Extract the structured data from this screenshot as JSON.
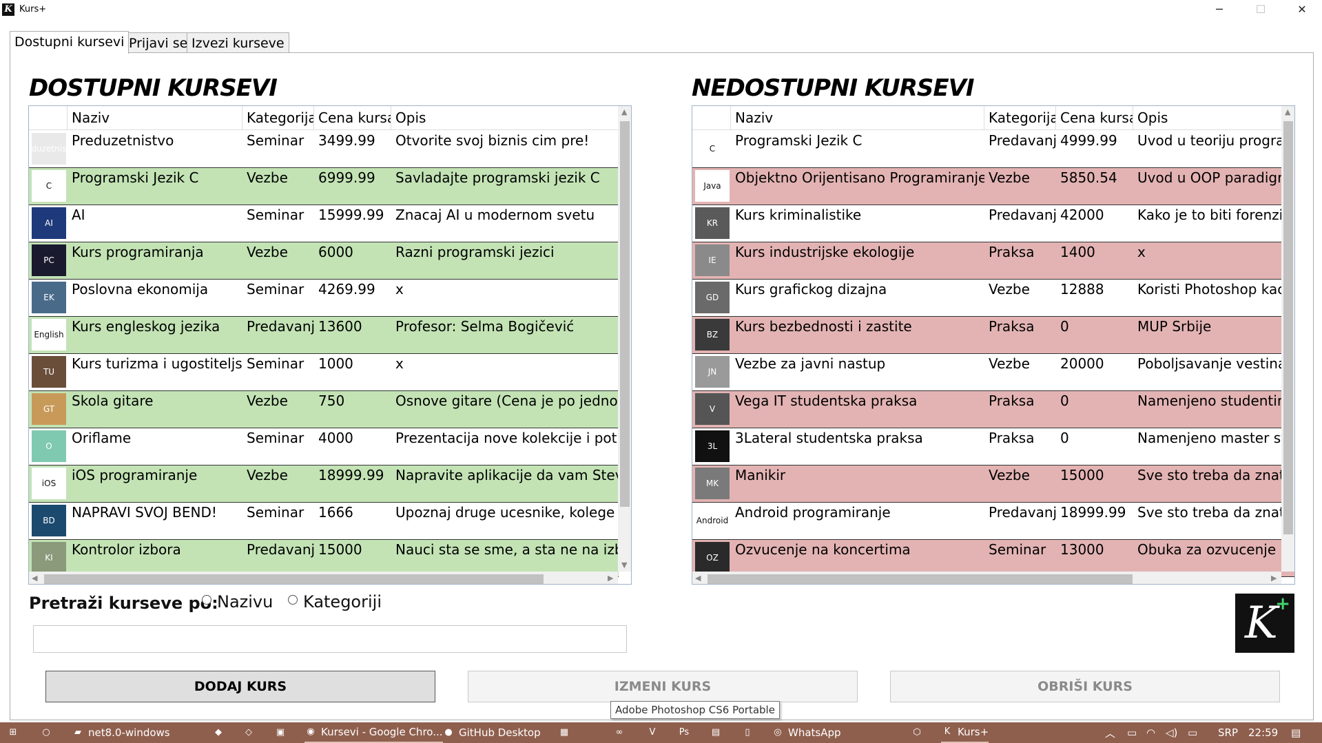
{
  "window": {
    "title": "Kurs+",
    "icon_letter": "K",
    "minimize": "─",
    "maximize": "☐",
    "close": "✕"
  },
  "tabs": [
    {
      "label": "Dostupni kursevi"
    },
    {
      "label": "Prijavi se"
    },
    {
      "label": "Izvezi kurseve"
    }
  ],
  "available": {
    "title": "DOSTUPNI KURSEVI",
    "columns": [
      "",
      "Naziv",
      "Kategorija",
      "Cena kursa",
      "Opis"
    ],
    "rows": [
      {
        "thumb": "Preduzetnistvo",
        "name": "Preduzetnistvo",
        "category": "Seminar",
        "price": "3499.99",
        "desc": "Otvorite svoj biznis cim pre!",
        "thumb_color": "#e9e9e9"
      },
      {
        "thumb": "C",
        "name": "Programski Jezik C",
        "category": "Vezbe",
        "price": "6999.99",
        "desc": "Savladajte programski jezik C",
        "thumb_color": "#ffffff"
      },
      {
        "thumb": "AI",
        "name": "AI",
        "category": "Seminar",
        "price": "15999.99",
        "desc": "Znacaj AI u modernom svetu",
        "thumb_color": "#1e3a7a"
      },
      {
        "thumb": "PC",
        "name": "Kurs programiranja",
        "category": "Vezbe",
        "price": "6000",
        "desc": "Razni programski jezici",
        "thumb_color": "#1a1a2e"
      },
      {
        "thumb": "EK",
        "name": "Poslovna ekonomija",
        "category": "Seminar",
        "price": "4269.99",
        "desc": "x",
        "thumb_color": "#4a6a8a"
      },
      {
        "thumb": "English",
        "name": "Kurs engleskog jezika",
        "category": "Predavanja",
        "price": "13600",
        "desc": "Profesor: Selma Bogičević",
        "thumb_color": "#ffffff"
      },
      {
        "thumb": "TU",
        "name": "Kurs turizma i ugostiteljstvo",
        "category": "Seminar",
        "price": "1000",
        "desc": "x",
        "thumb_color": "#6b4e3a"
      },
      {
        "thumb": "GT",
        "name": "Skola gitare",
        "category": "Vezbe",
        "price": "750",
        "desc": "Osnove gitare (Cena je po jednom ca",
        "thumb_color": "#c89a5a"
      },
      {
        "thumb": "O",
        "name": "Oriflame",
        "category": "Seminar",
        "price": "4000",
        "desc": "Prezentacija nove kolekcije i potraga",
        "thumb_color": "#7fc9b0"
      },
      {
        "thumb": "iOS",
        "name": "iOS programiranje",
        "category": "Vezbe",
        "price": "18999.99",
        "desc": "Napravite aplikacije da vam Steve Jol",
        "thumb_color": "#ffffff"
      },
      {
        "thumb": "BD",
        "name": "NAPRAVI SVOJ BEND!",
        "category": "Seminar",
        "price": "1666",
        "desc": "Upoznaj druge ucesnike, kolege muz",
        "thumb_color": "#1c4a6e"
      },
      {
        "thumb": "KI",
        "name": "Kontrolor izbora",
        "category": "Predavanja",
        "price": "15000",
        "desc": "Nauci sta se sme, a sta ne na izborim",
        "thumb_color": "#8a9a7a"
      }
    ]
  },
  "unavailable": {
    "title": "NEDOSTUPNI KURSEVI",
    "columns": [
      "",
      "Naziv",
      "Kategorija",
      "Cena kursa",
      "Opis"
    ],
    "rows": [
      {
        "thumb": "C",
        "name": "Programski Jezik C",
        "category": "Predavanja",
        "price": "4999.99",
        "desc": "Uvod u teoriju progra",
        "thumb_color": "#ffffff"
      },
      {
        "thumb": "Java",
        "name": "Objektno Orijentisano Programiranje - Java",
        "category": "Vezbe",
        "price": "5850.54",
        "desc": "Uvod u OOP paradigr",
        "thumb_color": "#ffffff"
      },
      {
        "thumb": "KR",
        "name": "Kurs kriminalistike",
        "category": "Predavanja",
        "price": "42000",
        "desc": "Kako je to biti forenzi",
        "thumb_color": "#5a5a5a"
      },
      {
        "thumb": "IE",
        "name": "Kurs industrijske ekologije",
        "category": "Praksa",
        "price": "1400",
        "desc": "x",
        "thumb_color": "#8a8a8a"
      },
      {
        "thumb": "GD",
        "name": "Kurs grafickog dizajna",
        "category": "Vezbe",
        "price": "12888",
        "desc": "Koristi Photoshop kac",
        "thumb_color": "#6a6a6a"
      },
      {
        "thumb": "BZ",
        "name": "Kurs bezbednosti i zastite",
        "category": "Praksa",
        "price": "0",
        "desc": "MUP Srbije",
        "thumb_color": "#3a3a3a"
      },
      {
        "thumb": "JN",
        "name": "Vezbe za javni nastup",
        "category": "Vezbe",
        "price": "20000",
        "desc": "Poboljsavanje vestina",
        "thumb_color": "#9a9a9a"
      },
      {
        "thumb": "V",
        "name": "Vega IT studentska praksa",
        "category": "Praksa",
        "price": "0",
        "desc": "Namenjeno studentin",
        "thumb_color": "#555555"
      },
      {
        "thumb": "3L",
        "name": "3Lateral studentska praksa",
        "category": "Praksa",
        "price": "0",
        "desc": "Namenjeno master st",
        "thumb_color": "#111111"
      },
      {
        "thumb": "MK",
        "name": "Manikir",
        "category": "Vezbe",
        "price": "15000",
        "desc": "Sve sto treba da znate",
        "thumb_color": "#7a7a7a"
      },
      {
        "thumb": "Android",
        "name": "Android programiranje",
        "category": "Predavanja",
        "price": "18999.99",
        "desc": "Sve sto treba da znate",
        "thumb_color": "#ffffff"
      },
      {
        "thumb": "OZ",
        "name": "Ozvucenje na koncertima",
        "category": "Seminar",
        "price": "13000",
        "desc": "Obuka za ozvucenje r",
        "thumb_color": "#2a2a2a"
      }
    ]
  },
  "search": {
    "label": "Pretraži kurseve po:",
    "options": [
      "Nazivu",
      "Kategoriji"
    ],
    "value": ""
  },
  "buttons": {
    "add": "DODAJ KURS",
    "edit": "IZMENI KURS",
    "delete": "OBRIŠI KURS"
  },
  "tooltip": "Adobe Photoshop CS6 Portable",
  "logo": {
    "letter": "K",
    "plus": "+"
  },
  "taskbar": {
    "items": [
      {
        "label": "net8.0-windows",
        "icon": "folder-icon"
      },
      {
        "label": "Kursevi - Google Chro...",
        "icon": "chrome-icon"
      },
      {
        "label": "GitHub Desktop",
        "icon": "github-icon"
      },
      {
        "label": "WhatsApp",
        "icon": "whatsapp-icon"
      },
      {
        "label": "Kurs+",
        "icon": "kursplus-icon"
      }
    ],
    "language": "SRP",
    "time": "22:59"
  },
  "colors": {
    "available_alt": "#c3e3b5",
    "unavailable_alt": "#e3b3b3",
    "taskbar": "#8f5f4e"
  }
}
